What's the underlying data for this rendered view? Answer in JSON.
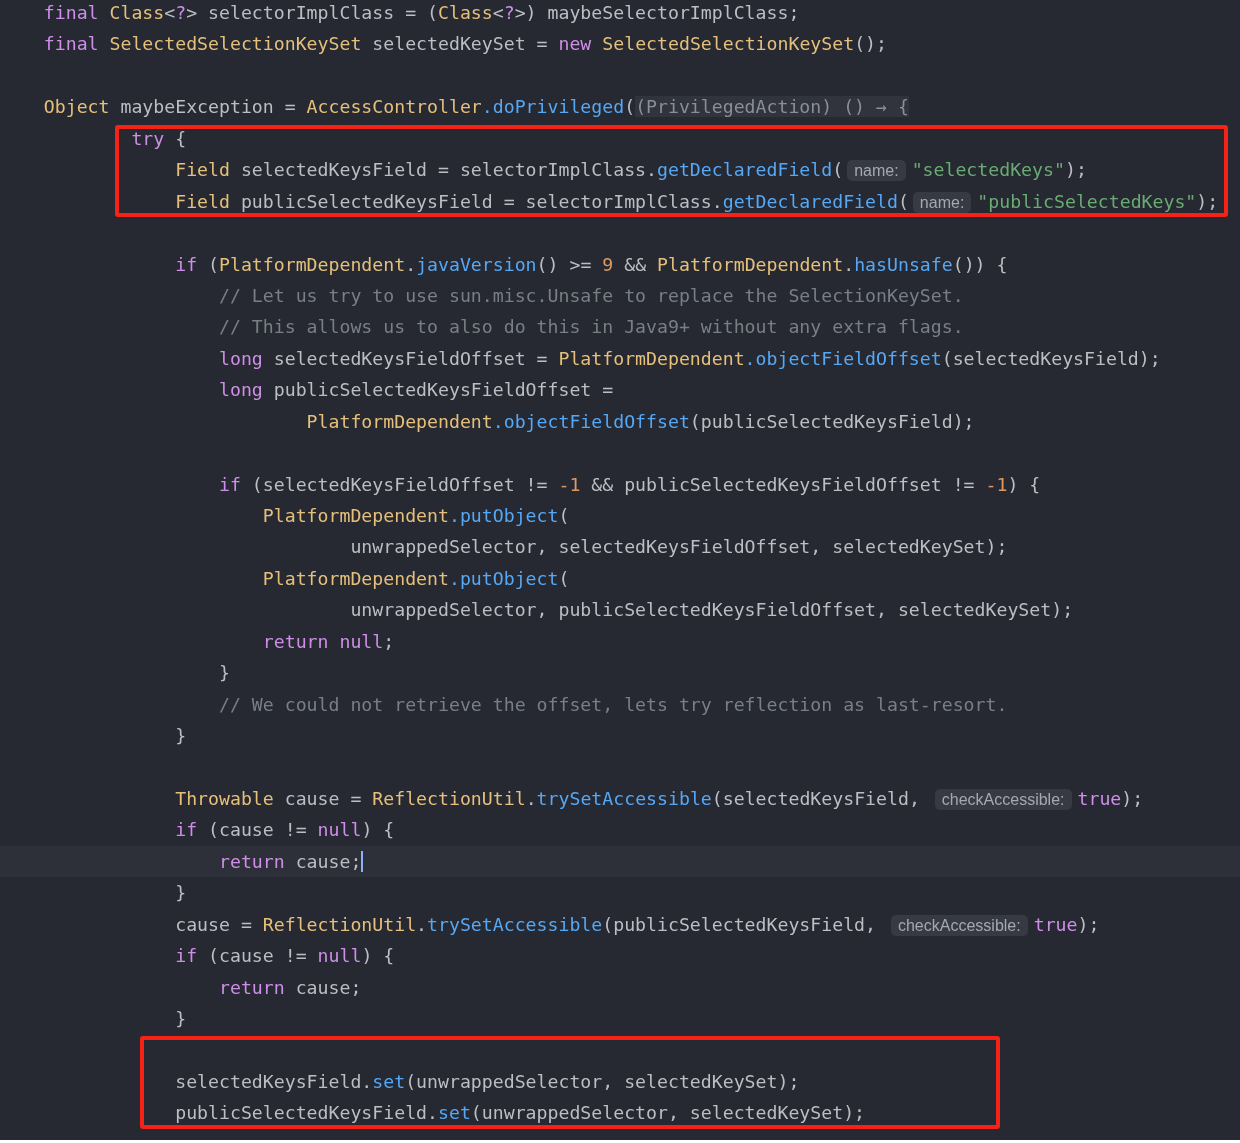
{
  "editor": {
    "blocks": [
      {
        "annotated": false,
        "lines": [
          {
            "kind": "code",
            "current": false,
            "tokens": [
              {
                "kind": "kw",
                "text": "    final "
              },
              {
                "kind": "type",
                "text": "Class"
              },
              {
                "kind": "plain",
                "text": "<"
              },
              {
                "kind": "kw",
                "text": "?"
              },
              {
                "kind": "plain",
                "text": "> selectorImplClass = ("
              },
              {
                "kind": "type",
                "text": "Class"
              },
              {
                "kind": "plain",
                "text": "<"
              },
              {
                "kind": "kw",
                "text": "?"
              },
              {
                "kind": "plain",
                "text": ">) maybeSelectorImplClass;"
              }
            ]
          },
          {
            "current": false,
            "tokens": [
              {
                "kind": "kw",
                "text": "    final "
              },
              {
                "kind": "type",
                "text": "SelectedSelectionKeySet"
              },
              {
                "kind": "plain",
                "text": " selectedKeySet = "
              },
              {
                "kind": "kw",
                "text": "new "
              },
              {
                "kind": "type",
                "text": "SelectedSelectionKeySet"
              },
              {
                "kind": "plain",
                "text": "();"
              }
            ]
          },
          {
            "kind": "blank"
          },
          {
            "current": false,
            "tokens": [
              {
                "kind": "type",
                "text": "    Object"
              },
              {
                "kind": "plain",
                "text": " maybeException = "
              },
              {
                "kind": "type",
                "text": "AccessController"
              },
              {
                "kind": "method",
                "text": ".doPrivileged"
              },
              {
                "kind": "plain",
                "text": "("
              },
              {
                "kind": "fold",
                "text": "(PrivilegedAction) () → {"
              }
            ]
          }
        ]
      },
      {
        "annotated": true,
        "lines": [
          {
            "current": false,
            "tokens": [
              {
                "kind": "kw",
                "text": "            try"
              },
              {
                "kind": "plain",
                "text": " {"
              }
            ]
          },
          {
            "current": false,
            "tokens": [
              {
                "kind": "type",
                "text": "                Field"
              },
              {
                "kind": "plain",
                "text": " selectedKeysField = selectorImplClass."
              },
              {
                "kind": "method",
                "text": "getDeclaredField"
              },
              {
                "kind": "plain",
                "text": "("
              },
              {
                "kind": "hint",
                "text": "name:"
              },
              {
                "kind": "str",
                "text": "\"selectedKeys\""
              },
              {
                "kind": "plain",
                "text": ");"
              }
            ]
          },
          {
            "current": false,
            "tokens": [
              {
                "kind": "type",
                "text": "                Field"
              },
              {
                "kind": "plain",
                "text": " publicSelectedKeysField = selectorImplClass."
              },
              {
                "kind": "method",
                "text": "getDeclaredField"
              },
              {
                "kind": "plain",
                "text": "("
              },
              {
                "kind": "hint",
                "text": "name:"
              },
              {
                "kind": "str",
                "text": "\"publicSelectedKeys\""
              },
              {
                "kind": "plain",
                "text": ");"
              }
            ]
          }
        ]
      },
      {
        "annotated": false,
        "lines": [
          {
            "kind": "blank"
          },
          {
            "current": false,
            "tokens": [
              {
                "kind": "kw",
                "text": "                if"
              },
              {
                "kind": "plain",
                "text": " ("
              },
              {
                "kind": "type",
                "text": "PlatformDependent"
              },
              {
                "kind": "plain",
                "text": "."
              },
              {
                "kind": "method",
                "text": "javaVersion"
              },
              {
                "kind": "plain",
                "text": "() >= "
              },
              {
                "kind": "num",
                "text": "9"
              },
              {
                "kind": "plain",
                "text": " && "
              },
              {
                "kind": "type",
                "text": "PlatformDependent"
              },
              {
                "kind": "plain",
                "text": "."
              },
              {
                "kind": "method",
                "text": "hasUnsafe"
              },
              {
                "kind": "plain",
                "text": "()) {"
              }
            ]
          },
          {
            "current": false,
            "tokens": [
              {
                "kind": "comment",
                "text": "                    // Let us try to use sun.misc.Unsafe to replace the SelectionKeySet."
              }
            ]
          },
          {
            "current": false,
            "tokens": [
              {
                "kind": "comment",
                "text": "                    // This allows us to also do this in Java9+ without any extra flags."
              }
            ]
          },
          {
            "current": false,
            "tokens": [
              {
                "kind": "kw",
                "text": "                    long"
              },
              {
                "kind": "plain",
                "text": " selectedKeysFieldOffset = "
              },
              {
                "kind": "type",
                "text": "PlatformDependent"
              },
              {
                "kind": "method",
                "text": ".objectFieldOffset"
              },
              {
                "kind": "plain",
                "text": "(selectedKeysField);"
              }
            ]
          },
          {
            "current": false,
            "tokens": [
              {
                "kind": "kw",
                "text": "                    long"
              },
              {
                "kind": "plain",
                "text": " publicSelectedKeysFieldOffset ="
              }
            ]
          },
          {
            "current": false,
            "tokens": [
              {
                "kind": "type",
                "text": "                            PlatformDependent"
              },
              {
                "kind": "method",
                "text": ".objectFieldOffset"
              },
              {
                "kind": "plain",
                "text": "(publicSelectedKeysField);"
              }
            ]
          },
          {
            "kind": "blank"
          },
          {
            "current": false,
            "tokens": [
              {
                "kind": "kw",
                "text": "                    if"
              },
              {
                "kind": "plain",
                "text": " (selectedKeysFieldOffset != "
              },
              {
                "kind": "num",
                "text": "-1"
              },
              {
                "kind": "plain",
                "text": " && publicSelectedKeysFieldOffset != "
              },
              {
                "kind": "num",
                "text": "-1"
              },
              {
                "kind": "plain",
                "text": ") {"
              }
            ]
          },
          {
            "current": false,
            "tokens": [
              {
                "kind": "type",
                "text": "                        PlatformDependent"
              },
              {
                "kind": "method",
                "text": ".putObject"
              },
              {
                "kind": "plain",
                "text": "("
              }
            ]
          },
          {
            "current": false,
            "tokens": [
              {
                "kind": "plain",
                "text": "                                unwrappedSelector, selectedKeysFieldOffset, selectedKeySet);"
              }
            ]
          },
          {
            "current": false,
            "tokens": [
              {
                "kind": "type",
                "text": "                        PlatformDependent"
              },
              {
                "kind": "method",
                "text": ".putObject"
              },
              {
                "kind": "plain",
                "text": "("
              }
            ]
          },
          {
            "current": false,
            "tokens": [
              {
                "kind": "plain",
                "text": "                                unwrappedSelector, publicSelectedKeysFieldOffset, selectedKeySet);"
              }
            ]
          },
          {
            "current": false,
            "tokens": [
              {
                "kind": "kw",
                "text": "                        return null"
              },
              {
                "kind": "plain",
                "text": ";"
              }
            ]
          },
          {
            "current": false,
            "tokens": [
              {
                "kind": "plain",
                "text": "                    }"
              }
            ]
          },
          {
            "current": false,
            "tokens": [
              {
                "kind": "comment",
                "text": "                    // We could not retrieve the offset, lets try reflection as last-resort."
              }
            ]
          },
          {
            "current": false,
            "tokens": [
              {
                "kind": "plain",
                "text": "                }"
              }
            ]
          },
          {
            "kind": "blank"
          },
          {
            "current": false,
            "tokens": [
              {
                "kind": "type",
                "text": "                Throwable"
              },
              {
                "kind": "plain",
                "text": " cause = "
              },
              {
                "kind": "type",
                "text": "ReflectionUtil"
              },
              {
                "kind": "plain",
                "text": "."
              },
              {
                "kind": "method",
                "text": "trySetAccessible"
              },
              {
                "kind": "plain",
                "text": "(selectedKeysField, "
              },
              {
                "kind": "hint",
                "text": "checkAccessible:"
              },
              {
                "kind": "kw",
                "text": "true"
              },
              {
                "kind": "plain",
                "text": ");"
              }
            ]
          },
          {
            "current": false,
            "tokens": [
              {
                "kind": "kw",
                "text": "                if"
              },
              {
                "kind": "plain",
                "text": " (cause != "
              },
              {
                "kind": "kw",
                "text": "null"
              },
              {
                "kind": "plain",
                "text": ") {"
              }
            ]
          },
          {
            "current": true,
            "tokens": [
              {
                "kind": "kw",
                "text": "                    return"
              },
              {
                "kind": "plain",
                "text": " cause;"
              }
            ]
          },
          {
            "current": false,
            "tokens": [
              {
                "kind": "plain",
                "text": "                }"
              }
            ]
          },
          {
            "current": false,
            "tokens": [
              {
                "kind": "plain",
                "text": "                cause = "
              },
              {
                "kind": "type",
                "text": "ReflectionUtil"
              },
              {
                "kind": "plain",
                "text": "."
              },
              {
                "kind": "method",
                "text": "trySetAccessible"
              },
              {
                "kind": "plain",
                "text": "(publicSelectedKeysField, "
              },
              {
                "kind": "hint",
                "text": "checkAccessible:"
              },
              {
                "kind": "kw",
                "text": "true"
              },
              {
                "kind": "plain",
                "text": ");"
              }
            ]
          },
          {
            "current": false,
            "tokens": [
              {
                "kind": "kw",
                "text": "                if"
              },
              {
                "kind": "plain",
                "text": " (cause != "
              },
              {
                "kind": "kw",
                "text": "null"
              },
              {
                "kind": "plain",
                "text": ") {"
              }
            ]
          },
          {
            "current": false,
            "tokens": [
              {
                "kind": "kw",
                "text": "                    return"
              },
              {
                "kind": "plain",
                "text": " cause;"
              }
            ]
          },
          {
            "current": false,
            "tokens": [
              {
                "kind": "plain",
                "text": "                }"
              }
            ]
          }
        ]
      },
      {
        "annotated": true,
        "lines": [
          {
            "kind": "blank"
          },
          {
            "current": false,
            "tokens": [
              {
                "kind": "plain",
                "text": "                selectedKeysField."
              },
              {
                "kind": "method",
                "text": "set"
              },
              {
                "kind": "plain",
                "text": "(unwrappedSelector, selectedKeySet);"
              }
            ]
          },
          {
            "current": false,
            "tokens": [
              {
                "kind": "plain",
                "text": "                publicSelectedKeysField."
              },
              {
                "kind": "method",
                "text": "set"
              },
              {
                "kind": "plain",
                "text": "(unwrappedSelector, selectedKeySet);"
              }
            ]
          }
        ]
      }
    ]
  }
}
